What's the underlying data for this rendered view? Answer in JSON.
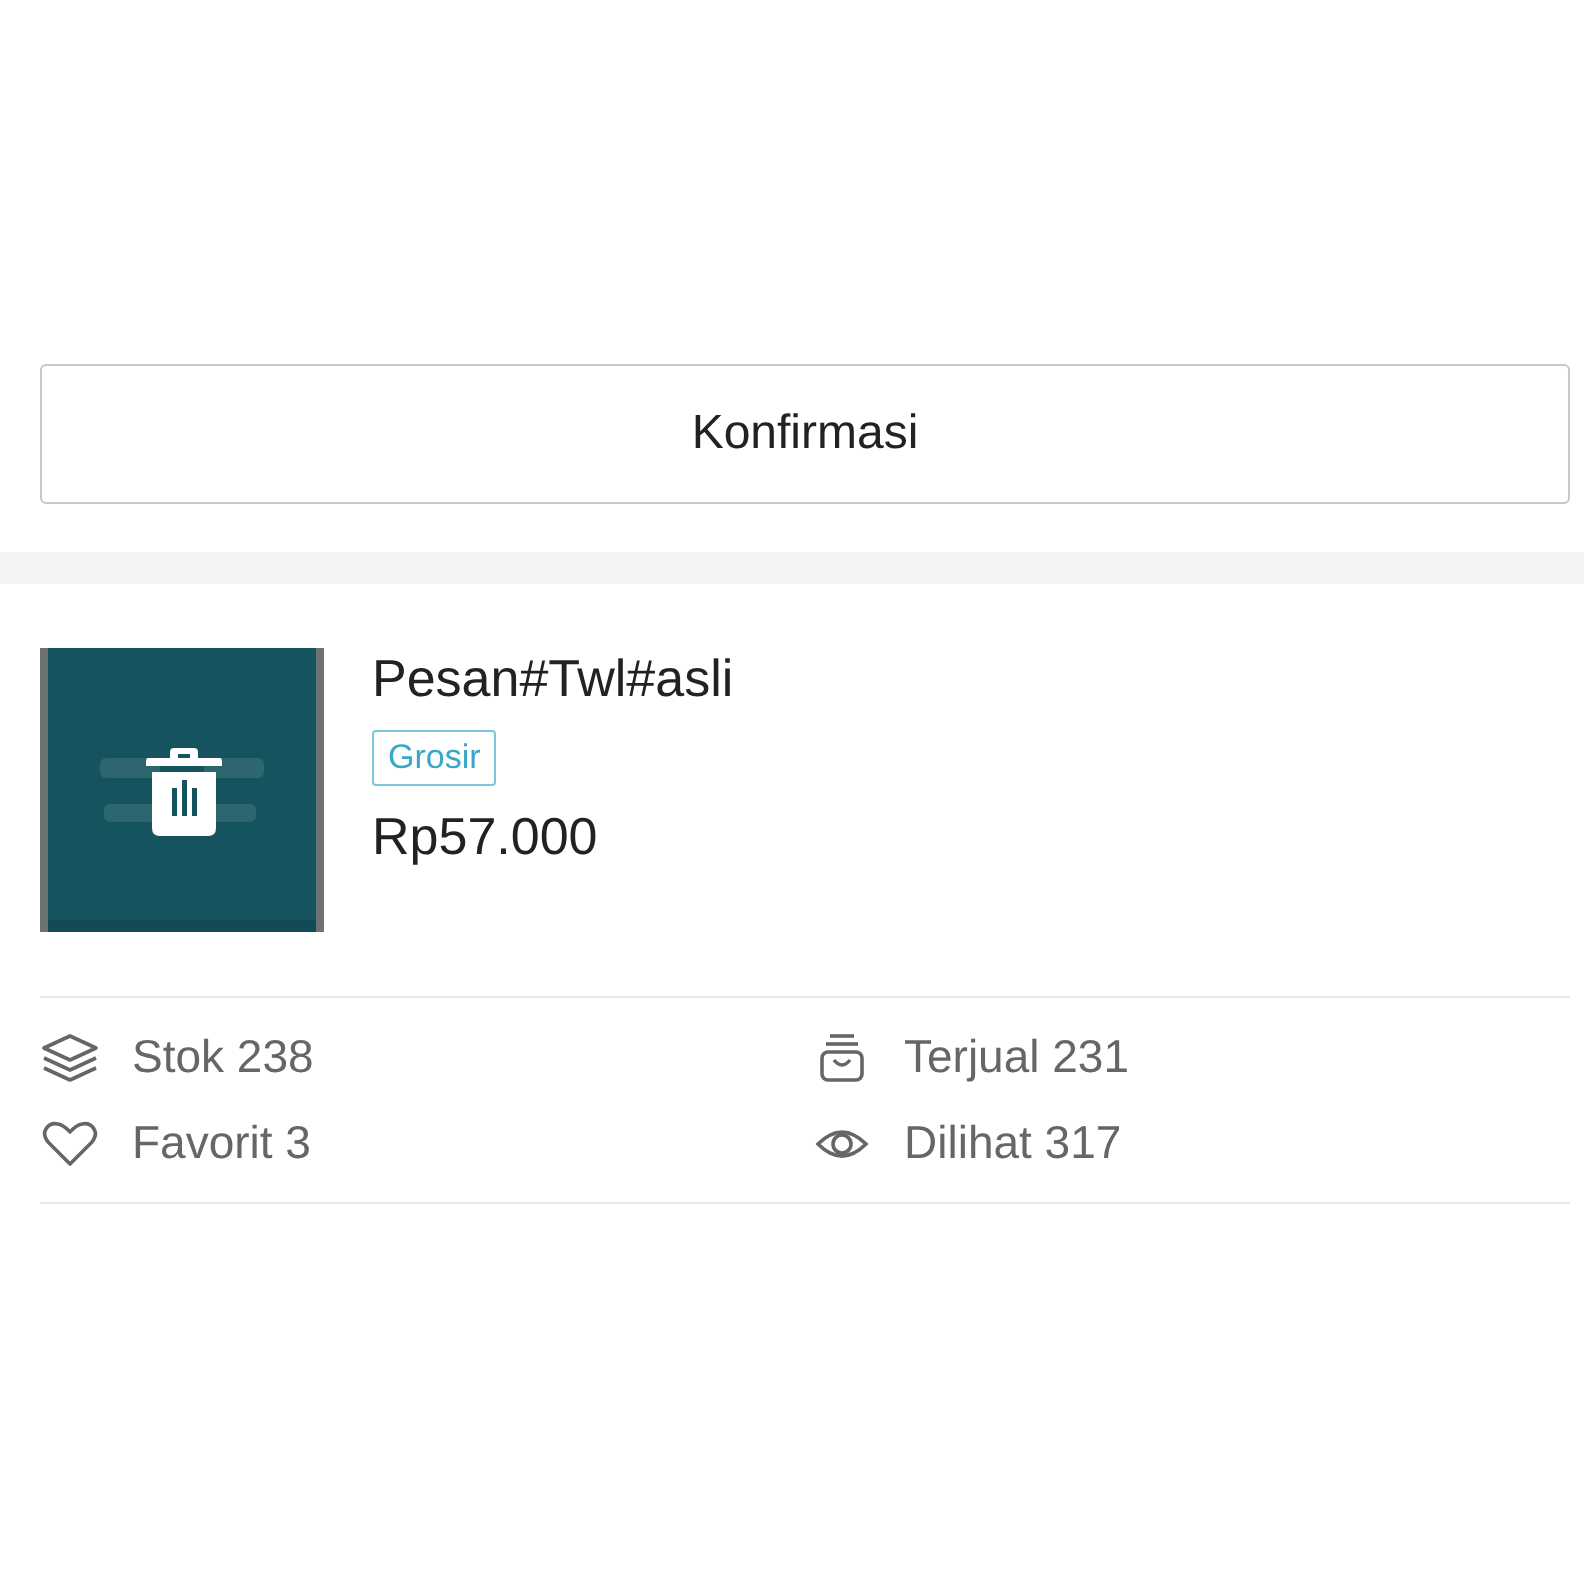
{
  "confirm_button": {
    "label": "Konfirmasi"
  },
  "product": {
    "name": "Pesan#Twl#asli",
    "tag": "Grosir",
    "price": "Rp57.000"
  },
  "stats": [
    {
      "kind": "stock",
      "label": "Stok 238"
    },
    {
      "kind": "sold",
      "label": "Terjual 231"
    },
    {
      "kind": "favorite",
      "label": "Favorit 3"
    },
    {
      "kind": "views",
      "label": "Dilihat 317"
    }
  ]
}
